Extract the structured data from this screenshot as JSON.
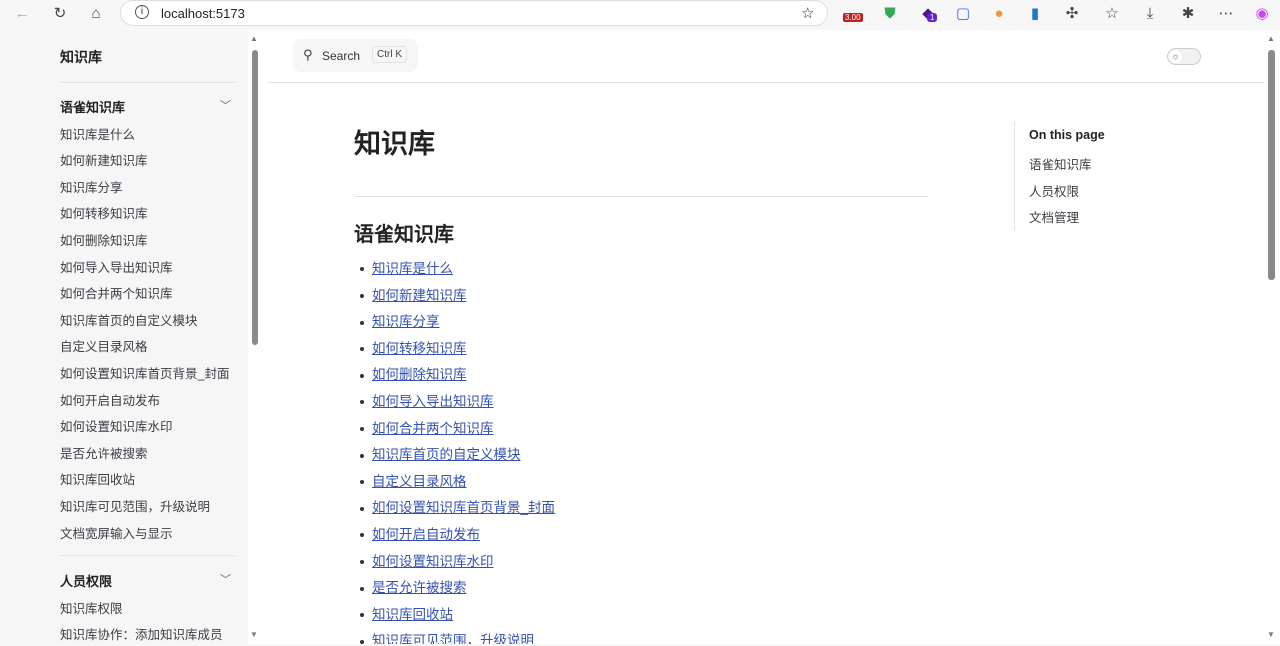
{
  "browser": {
    "url": "localhost:5173",
    "ext_badge": "3.00",
    "ext_count": "1"
  },
  "sidebar": {
    "title": "知识库",
    "sections": [
      {
        "title": "语雀知识库",
        "items": [
          "知识库是什么",
          "如何新建知识库",
          "知识库分享",
          "如何转移知识库",
          "如何删除知识库",
          "如何导入导出知识库",
          "如何合并两个知识库",
          "知识库首页的自定义模块",
          "自定义目录风格",
          "如何设置知识库首页背景_封面",
          "如何开启自动发布",
          "如何设置知识库水印",
          "是否允许被搜索",
          "知识库回收站",
          "知识库可见范围，升级说明",
          "文档宽屏输入与显示"
        ]
      },
      {
        "title": "人员权限",
        "items": [
          "知识库权限",
          "知识库协作：添加知识库成员"
        ]
      }
    ]
  },
  "header": {
    "search_label": "Search",
    "search_shortcut": "Ctrl K"
  },
  "main": {
    "title": "知识库",
    "section_title": "语雀知识库",
    "links": [
      "知识库是什么",
      "如何新建知识库",
      "知识库分享",
      "如何转移知识库",
      "如何删除知识库",
      "如何导入导出知识库",
      "如何合并两个知识库",
      "知识库首页的自定义模块",
      "自定义目录风格",
      "如何设置知识库首页背景_封面",
      "如何开启自动发布",
      "如何设置知识库水印",
      "是否允许被搜索",
      "知识库回收站",
      "知识库可见范围，升级说明"
    ]
  },
  "outline": {
    "title": "On this page",
    "items": [
      "语雀知识库",
      "人员权限",
      "文档管理"
    ]
  }
}
